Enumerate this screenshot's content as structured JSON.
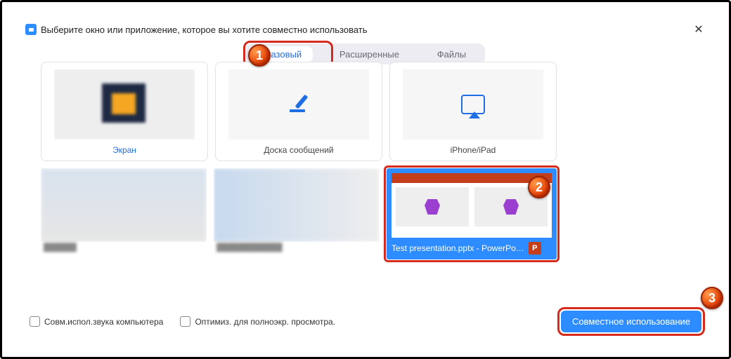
{
  "window": {
    "title": "Выберите окно или приложение, которое вы хотите совместно использовать"
  },
  "tabs": {
    "basic": "Базовый",
    "advanced": "Расширенные",
    "files": "Файлы"
  },
  "tiles": {
    "screen": "Экран",
    "whiteboard": "Доска сообщений",
    "iphone": "iPhone/iPad",
    "ppt_caption": "Test presentation.pptx - PowerPo…",
    "ppt_icon_letter": "P"
  },
  "footer": {
    "share_audio": "Совм.испол.звука компьютера",
    "optimize": "Оптимиз. для полноэкр. просмотра.",
    "share_button": "Совместное использование"
  },
  "annotations": {
    "b1": "1",
    "b2": "2",
    "b3": "3"
  }
}
